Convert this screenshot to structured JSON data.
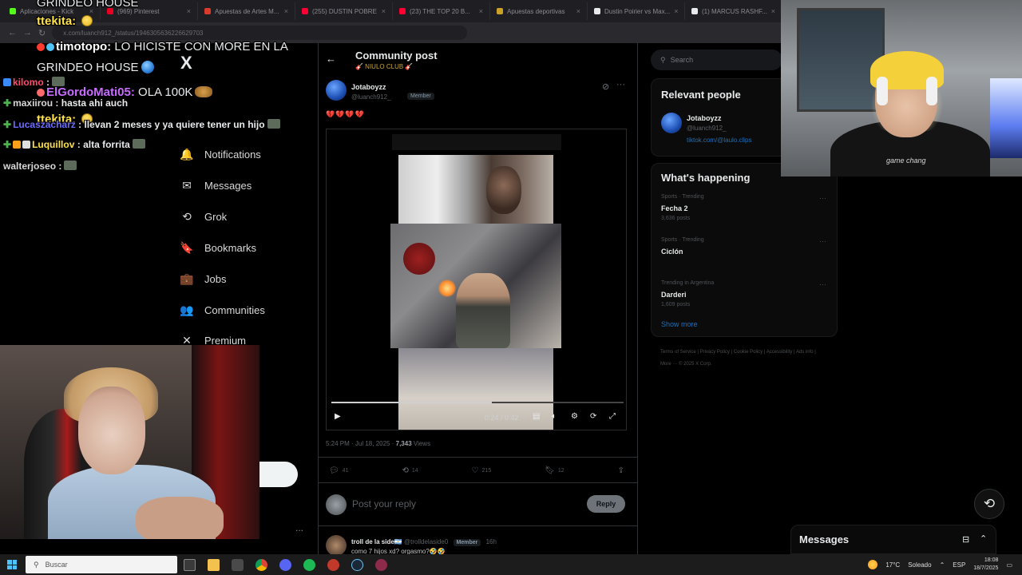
{
  "browser": {
    "tabs": [
      {
        "label": "Aplicaciones - Kick",
        "color": "#53fc18"
      },
      {
        "label": "(969) Pinterest",
        "color": "#e60023"
      },
      {
        "label": "Apuestas de Artes M...",
        "color": "#d93a2b"
      },
      {
        "label": "(255) DUSTIN POBRE",
        "color": "#ff0033"
      },
      {
        "label": "(23) THE TOP 20 B...",
        "color": "#ff0033"
      },
      {
        "label": "Apuestas deportivas",
        "color": "#c9a227"
      },
      {
        "label": "Dustin Poirier vs Max...",
        "color": "#e7e9ea"
      },
      {
        "label": "(1) MARCUS RASHF...",
        "color": "#e7e9ea"
      }
    ],
    "url": "x.com/luanch912_/status/1946305636226629703"
  },
  "sidebar": {
    "logo": "X",
    "items": [
      {
        "label": "Notifications",
        "icon": "bell-icon",
        "glyph": "🔔"
      },
      {
        "label": "Messages",
        "icon": "envelope-icon",
        "glyph": "✉"
      },
      {
        "label": "Grok",
        "icon": "grok-icon",
        "glyph": "⟲"
      },
      {
        "label": "Bookmarks",
        "icon": "bookmark-icon",
        "glyph": "🔖"
      },
      {
        "label": "Jobs",
        "icon": "briefcase-icon",
        "glyph": "💼"
      },
      {
        "label": "Communities",
        "icon": "people-icon",
        "glyph": "👥"
      },
      {
        "label": "Premium",
        "icon": "x-premium-icon",
        "glyph": "✕"
      }
    ],
    "more": "..."
  },
  "post": {
    "header_title": "Community post",
    "community_name": "🎸 NIULO CLUB 🎸",
    "author_name": "Jotaboyzz",
    "author_handle": "@luanch912_",
    "member_badge": "Member",
    "emojis": "💔💔💔💔",
    "video": {
      "time": "0:24 / 0:42",
      "progress": 0.55
    },
    "timestamp": "5:24 PM · Jul 18, 2025 ·",
    "views_count": "7,343",
    "views_label": "Views",
    "actions": {
      "replies": "41",
      "reposts": "14",
      "likes": "215",
      "bookmarks": "12"
    },
    "reply_placeholder": "Post your reply",
    "reply_button": "Reply",
    "next_reply_name": "troll de la side🇦🇷",
    "next_reply_handle": "@trolldelaside0",
    "next_reply_badge": "Member",
    "next_reply_time": "16h",
    "next_reply_text": "como 7 hijos xd? orgasmo?🤣🤣"
  },
  "right": {
    "search_placeholder": "Search",
    "relevant_title": "Relevant people",
    "relevant_name": "Jotaboyzz",
    "relevant_handle": "@luanch912_",
    "relevant_link": "tiktok.com/@laulo.clips",
    "happening_title": "What's happening",
    "trends": [
      {
        "category": "Sports · Trending",
        "name": "Fecha 2",
        "count": "3,636 posts"
      },
      {
        "category": "Sports · Trending",
        "name": "Ciclón",
        "count": ""
      },
      {
        "category": "Trending in Argentina",
        "name": "Darderi",
        "count": "1,609 posts"
      }
    ],
    "show_more": "Show more",
    "footer": "Terms of Service | Privacy Policy | Cookie Policy | Accessibility | Ads info | More ··· © 2025 X Corp."
  },
  "messages_label": "Messages",
  "chat": [
    {
      "user": "",
      "message": "GRINDEO HOUSE",
      "color": "#ffffff"
    },
    {
      "user": "ttekita:",
      "message": "",
      "color": "#ffe14a"
    },
    {
      "user": "timotopo:",
      "message": "LO HICISTE CON MORE EN LA",
      "color": "#ffffff"
    },
    {
      "user": "",
      "message": "GRINDEO HOUSE",
      "color": "#ffffff"
    },
    {
      "user": "ElGordoMati05:",
      "message": "OLA 100K",
      "color": "#c86bff"
    },
    {
      "user": "ttekita:",
      "message": "",
      "color": "#ffe14a"
    },
    {
      "user": "kilomo",
      "message": ":",
      "color": "#ff4b6e"
    },
    {
      "user": "maxiirou",
      "message": ": hasta ahi auch",
      "color": "#d8d8d8"
    },
    {
      "user": "Lucaszacharz",
      "message": ": llevan 2 meses y ya quiere tener un hijo",
      "color": "#6b6bff"
    },
    {
      "user": "Luquillov",
      "message": ": alta forrita",
      "color": "#ffe14a"
    },
    {
      "user": "walterjoseo",
      "message": ":",
      "color": "#d8d8d8"
    }
  ],
  "webcam": {
    "shirt_text": "game chang"
  },
  "taskbar": {
    "search_placeholder": "Buscar",
    "weather": "17°C",
    "weather_desc": "Soleado",
    "lang": "ESP",
    "time": "18:08",
    "date": "18/7/2025"
  }
}
